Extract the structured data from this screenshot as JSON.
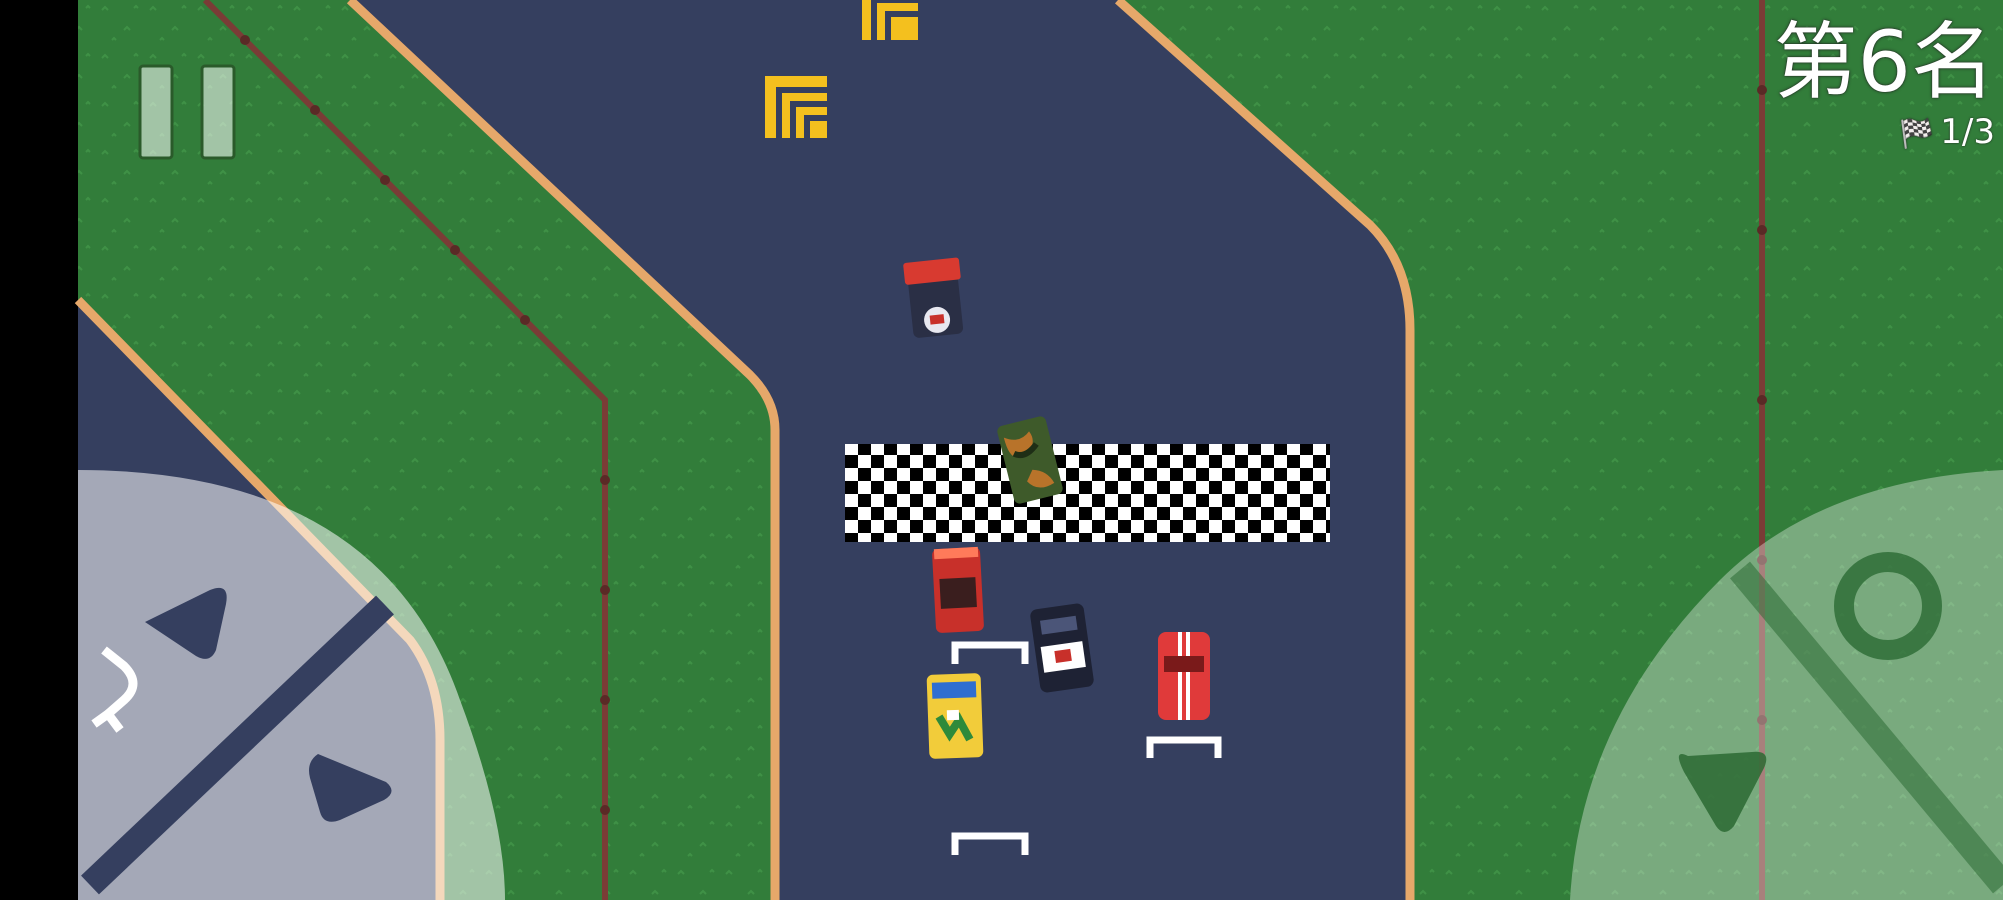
{
  "hud": {
    "position_label": "第6名",
    "lap_flag_icon": "checkered-flag-icon",
    "lap_counter": "1/3"
  },
  "controls": {
    "pause_icon": "pause-icon",
    "left_pad": {
      "steer_left_icon": "triangle-left-icon",
      "steer_right_icon": "triangle-right-icon",
      "reverse_icon": "u-turn-arrow-icon"
    },
    "right_pad": {
      "accelerate_icon": "ring-icon",
      "brake_icon": "triangle-down-icon"
    }
  },
  "colors": {
    "grass": "#327d3a",
    "road": "#353f5f",
    "curb": "#e6a86a",
    "fence": "#7a3c36",
    "hud_text": "#ffffff",
    "player_car": "#e03a3a"
  }
}
